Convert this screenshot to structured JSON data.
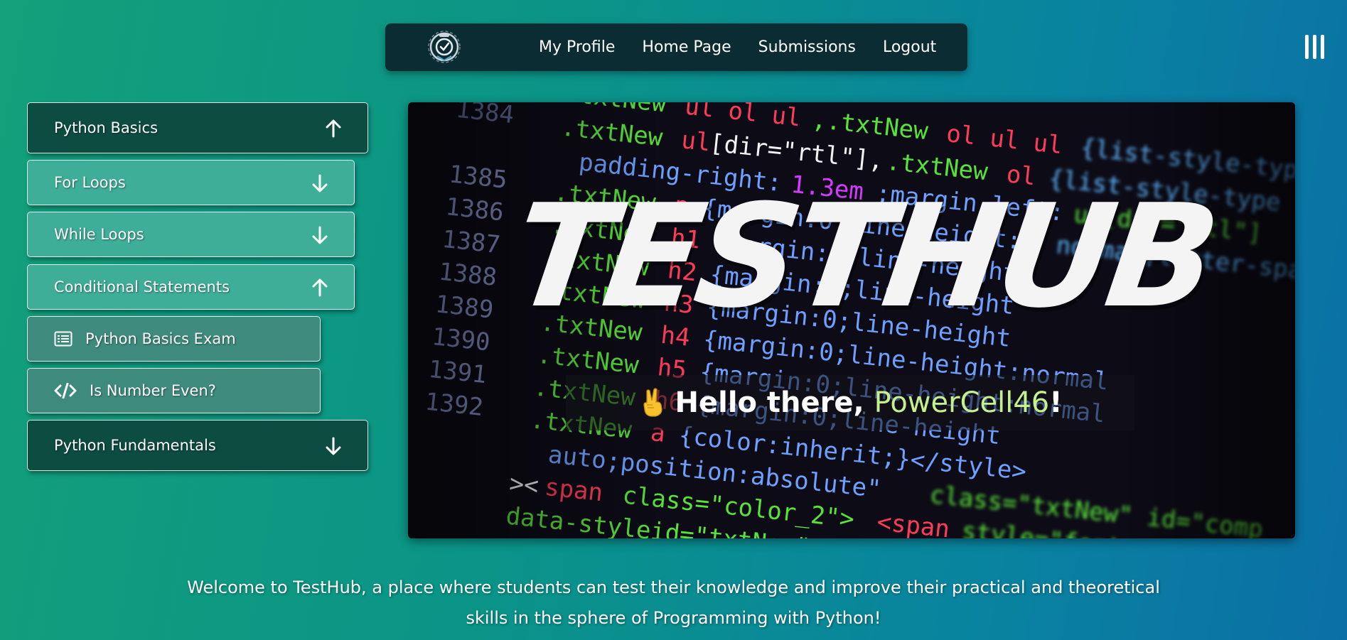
{
  "navbar": {
    "logo_icon": "shield-check-icon",
    "links": [
      "My Profile",
      "Home Page",
      "Submissions",
      "Logout"
    ],
    "menu_icon": "hamburger-icon"
  },
  "sidebar": {
    "items": [
      {
        "label": "Python Basics",
        "state": "expanded",
        "arrow": "up"
      },
      {
        "label": "For Loops",
        "state": "collapsed",
        "arrow": "down"
      },
      {
        "label": "While Loops",
        "state": "collapsed",
        "arrow": "down"
      },
      {
        "label": "Conditional Statements",
        "state": "expanded",
        "arrow": "up"
      },
      {
        "label": "Python Basics Exam",
        "icon": "list-icon"
      },
      {
        "label": "Is Number Even?",
        "icon": "code-icon"
      },
      {
        "label": "Python Fundamentals",
        "state": "collapsed",
        "arrow": "down"
      }
    ]
  },
  "hero": {
    "title": "TESTHUB",
    "greeting_prefix": "Hello there, ",
    "username": "PowerCell46",
    "greeting_suffix": "!",
    "emoji": "victory-hand"
  },
  "welcome": {
    "line1": "Welcome to TestHub, a place where students can test their knowledge and improve their practical and theoretical",
    "line2": "skills in the sphere of Programming with Python!"
  },
  "colors": {
    "nav_bg": "#0b2c33",
    "dark_item": "#0d4c41",
    "light_item": "#3fae98",
    "username": "#c6f08e"
  }
}
